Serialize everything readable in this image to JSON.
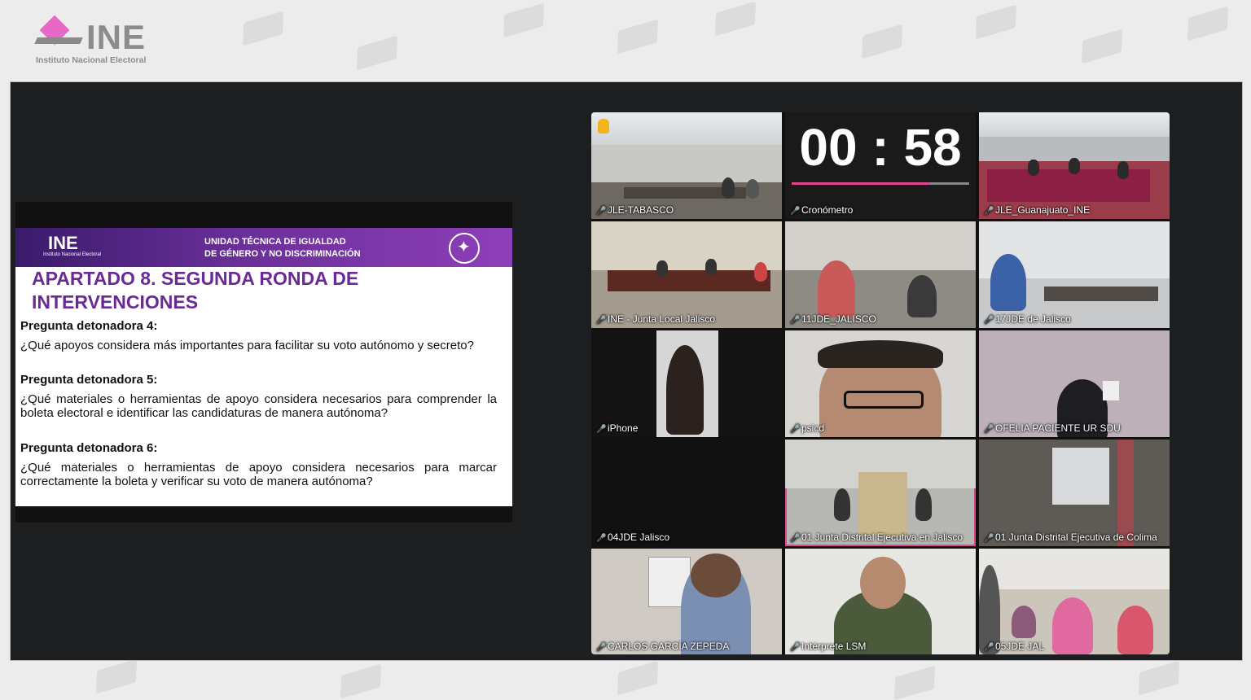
{
  "branding": {
    "logo_text": "INE",
    "logo_subtitle": "Instituto Nacional Electoral"
  },
  "slide": {
    "ine_text": "INE",
    "ine_sub": "Instituto Nacional Electoral",
    "unit_line1": "UNIDAD TÉCNICA DE IGUALDAD",
    "unit_line2": "DE GÉNERO Y NO DISCRIMINACIÓN",
    "title": "APARTADO 8. SEGUNDA RONDA DE INTERVENCIONES",
    "q4_head": "Pregunta detonadora 4:",
    "q4_text": "¿Qué apoyos considera más importantes para facilitar su voto autónomo y secreto?",
    "q5_head": "Pregunta detonadora 5:",
    "q5_text": "¿Qué materiales o herramientas de apoyo considera necesarios para comprender la boleta electoral e identificar las candidaturas de manera autónoma?",
    "q6_head": "Pregunta detonadora 6:",
    "q6_text": "¿Qué materiales o herramientas de apoyo considera necesarios para marcar correctamente la boleta y verificar su voto de manera autónoma?"
  },
  "timer": {
    "display": "00 : 58",
    "progress": 0.78
  },
  "participants": [
    {
      "name": "JLE-TABASCO"
    },
    {
      "name": "Cronómetro"
    },
    {
      "name": "JLE_Guanajuato_INE"
    },
    {
      "name": "INE - Junta Local Jalisco"
    },
    {
      "name": "11JDE_JALISCO"
    },
    {
      "name": "17JDE de Jalisco"
    },
    {
      "name": "iPhone"
    },
    {
      "name": "psicd"
    },
    {
      "name": "OFELIA PACIENTE UR SDU"
    },
    {
      "name": "04JDE Jalisco"
    },
    {
      "name": "01 Junta Distrital Ejecutiva en Jalisco"
    },
    {
      "name": "01 Junta Distrital Ejecutiva de Colima"
    },
    {
      "name": "CARLOS GARCÍA ZEPEDA"
    },
    {
      "name": "Intérprete LSM"
    },
    {
      "name": "05JDE JAL"
    }
  ],
  "colors": {
    "accent": "#d94a8f",
    "slide_title": "#6a2a95",
    "mic_muted": "#e2413a"
  }
}
